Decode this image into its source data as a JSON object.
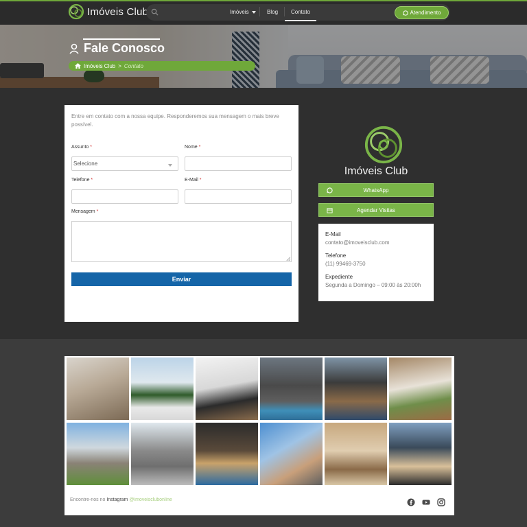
{
  "nav": {
    "brand": "Imóveis Club",
    "menu": [
      {
        "label": "Imóveis",
        "has_dropdown": true
      },
      {
        "label": "Blog"
      },
      {
        "label": "Contato",
        "active": true
      }
    ],
    "cta_label": "Atendimento"
  },
  "hero": {
    "title": "Fale Conosco",
    "breadcrumb_home": "Imóveis Club",
    "breadcrumb_separator": ">",
    "breadcrumb_current": "Contato"
  },
  "form": {
    "intro": "Entre em contato com a nossa equipe. Responderemos sua mensagem o mais breve possível.",
    "required_mark": "*",
    "assunto_label": "Assunto",
    "assunto_value": "Selecione",
    "nome_label": "Nome",
    "telefone_label": "Telefone",
    "email_label": "E-Mail",
    "mensagem_label": "Mensagem",
    "submit_label": "Enviar"
  },
  "sidebar": {
    "brand_name": "Imóveis Club",
    "whatsapp_label": "WhatsApp",
    "visitas_label": "Agendar Visitas",
    "email_label": "E-Mail",
    "email_value": "contato@imoveisclub.com",
    "telefone_label": "Telefone",
    "telefone_value": "(11) 99469-3750",
    "expediente_label": "Expediente",
    "expediente_value": "Segunda a Domingo – 09:00 às 20:00h"
  },
  "instagram": {
    "text_prefix": "Encontre-nos no",
    "network": "Instagram",
    "handle": "@imoveisclubonline"
  },
  "colors": {
    "brand_green": "#6fa83a",
    "submit_blue": "#1565a8",
    "dark_bg": "#2f2f2f"
  }
}
